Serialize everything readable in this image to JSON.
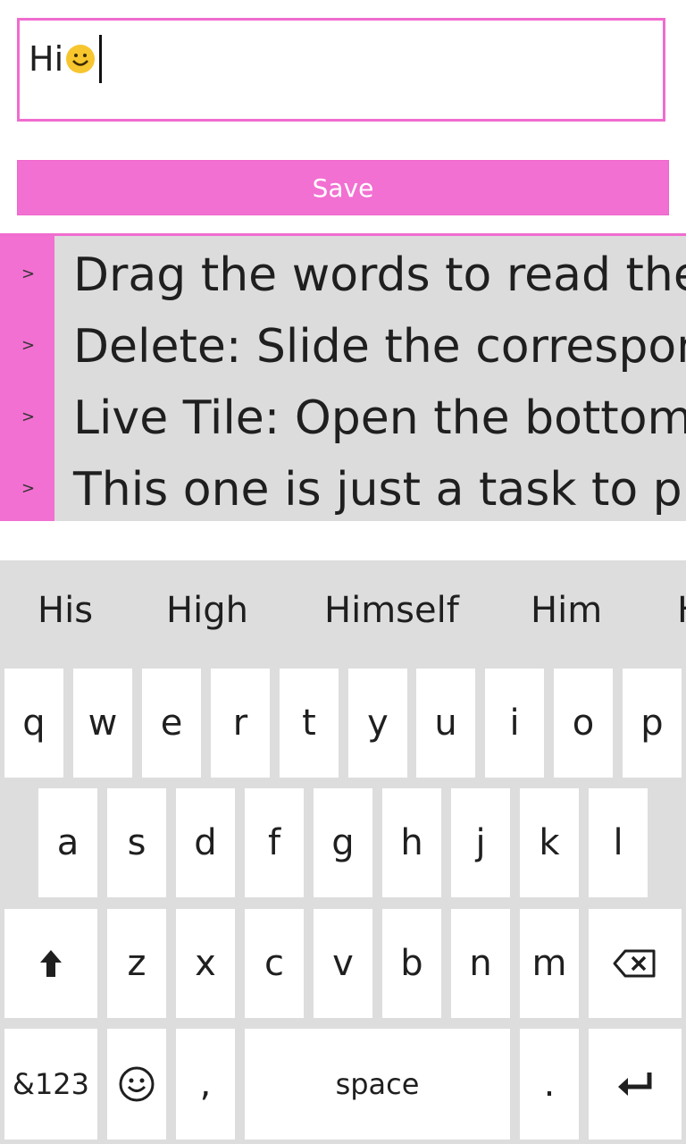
{
  "input": {
    "value": "Hi"
  },
  "save_button": {
    "label": "Save"
  },
  "tasks": [
    {
      "text": "Drag the words to read the re"
    },
    {
      "text": "Delete: Slide the correspondi"
    },
    {
      "text": "Live Tile: Open the bottom m"
    },
    {
      "text": "This one is just a task to prac"
    }
  ],
  "task_chevron": ">",
  "keyboard": {
    "suggestions": [
      "His",
      "High",
      "Himself",
      "Him",
      "H"
    ],
    "row1": [
      "q",
      "w",
      "e",
      "r",
      "t",
      "y",
      "u",
      "i",
      "o",
      "p"
    ],
    "row2": [
      "a",
      "s",
      "d",
      "f",
      "g",
      "h",
      "j",
      "k",
      "l"
    ],
    "row3": [
      "z",
      "x",
      "c",
      "v",
      "b",
      "n",
      "m"
    ],
    "numbers_key": "&123",
    "comma_key": ",",
    "space_key": "space",
    "period_key": ".",
    "icons": {
      "shift": "shift-arrow-icon",
      "backspace": "backspace-icon",
      "emoji": "emoji-icon",
      "enter": "enter-icon"
    }
  },
  "colors": {
    "accent": "#f270d2",
    "list_bg": "#dcdcdc",
    "keyboard_bg": "#dddddd"
  }
}
